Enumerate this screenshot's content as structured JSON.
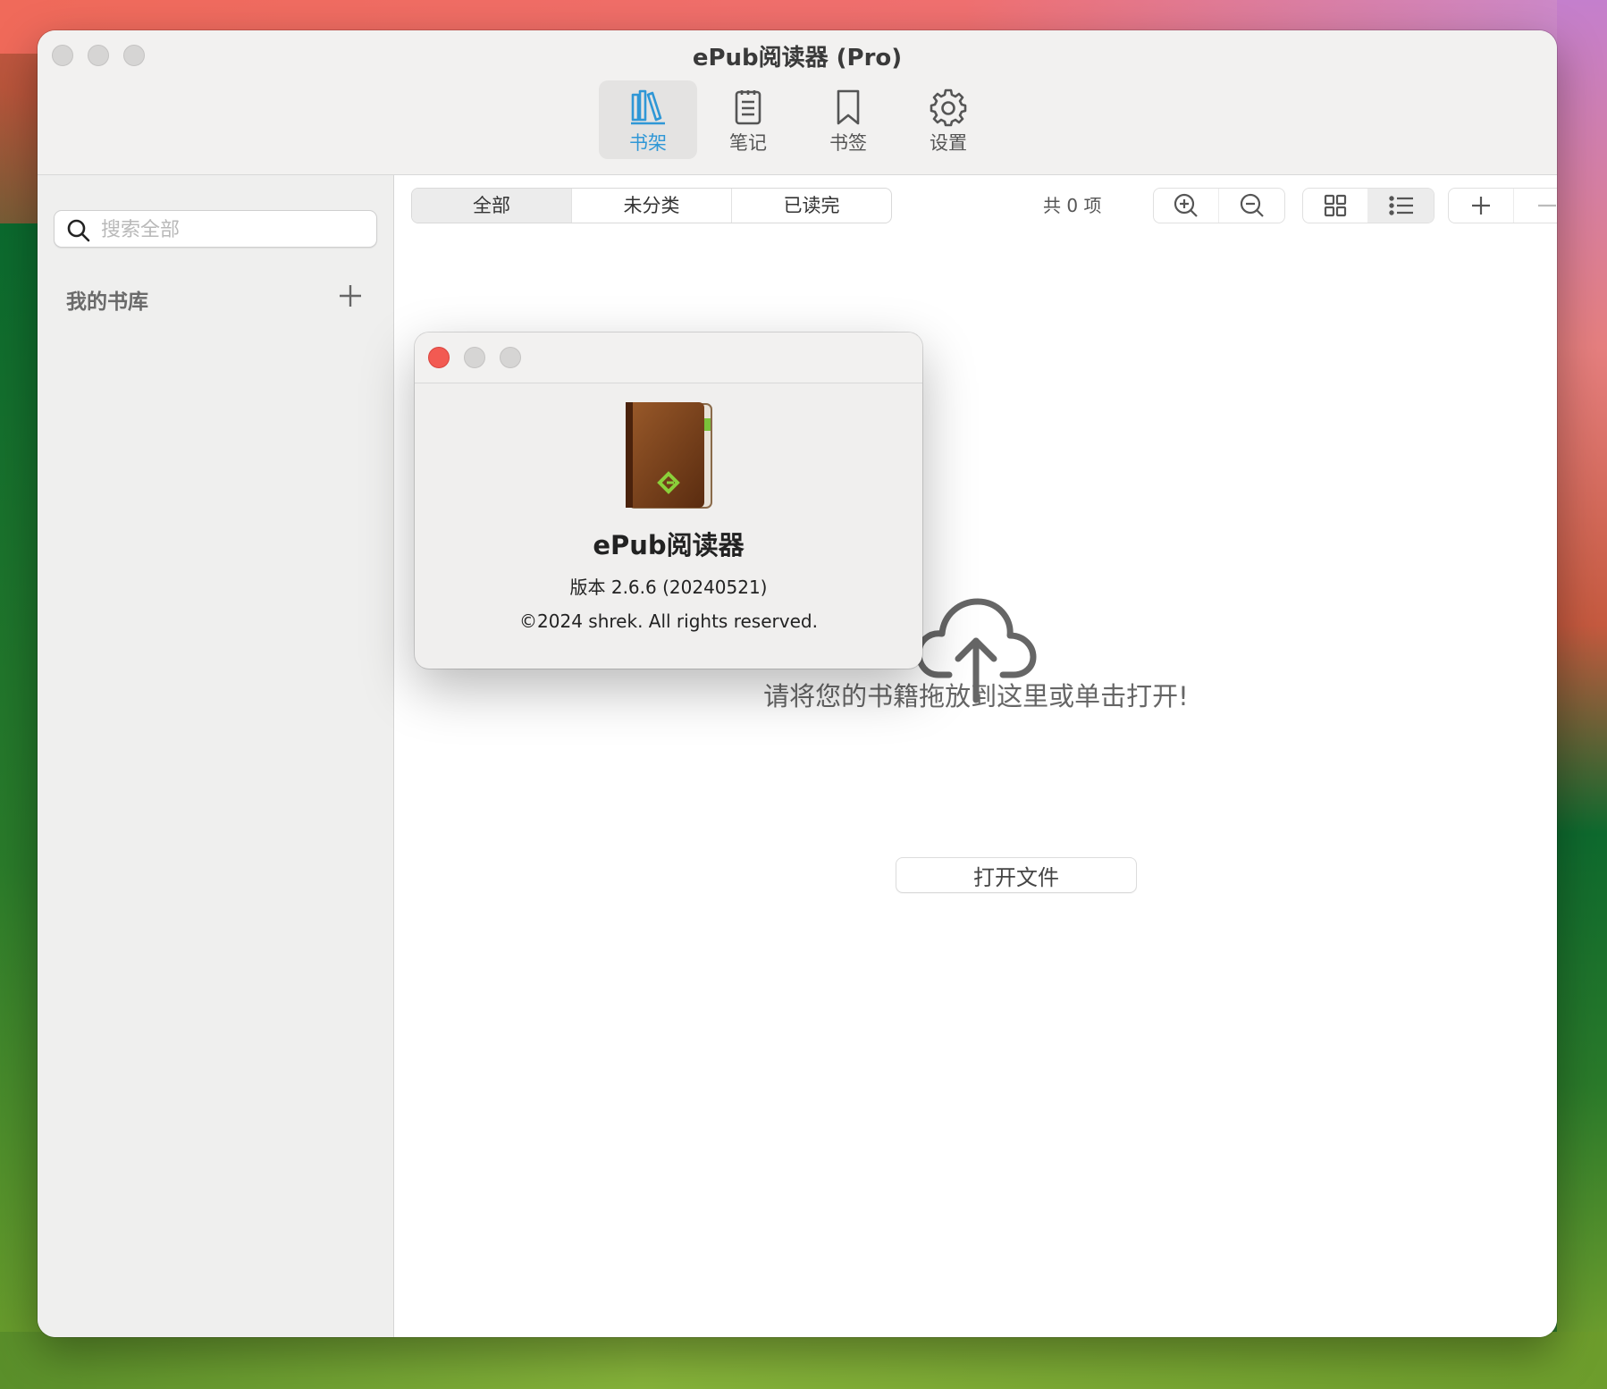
{
  "window": {
    "title": "ePub阅读器 (Pro)"
  },
  "toolbar": {
    "items": [
      {
        "label": "书架",
        "icon": "bookshelf-icon",
        "active": true
      },
      {
        "label": "笔记",
        "icon": "notes-icon",
        "active": false
      },
      {
        "label": "书签",
        "icon": "bookmark-icon",
        "active": false
      },
      {
        "label": "设置",
        "icon": "gear-icon",
        "active": false
      }
    ],
    "accent_color": "#2f97d6"
  },
  "sidebar": {
    "search_placeholder": "搜索全部",
    "library_title": "我的书库"
  },
  "content": {
    "filters": [
      {
        "label": "全部",
        "active": true
      },
      {
        "label": "未分类",
        "active": false
      },
      {
        "label": "已读完",
        "active": false
      }
    ],
    "count_label": "共 0 项",
    "drop_hint": "请将您的书籍拖放到这里或单击打开!",
    "open_button": "打开文件"
  },
  "about": {
    "app_name": "ePub阅读器",
    "version": "版本 2.6.6 (20240521)",
    "copyright": "©2024 shrek. All rights reserved."
  }
}
